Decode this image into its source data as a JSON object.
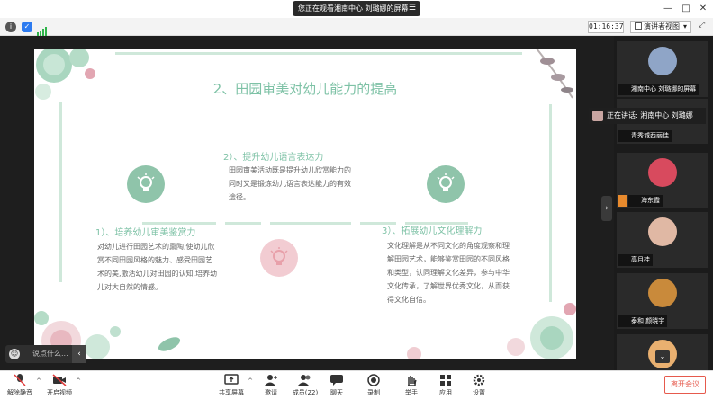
{
  "titlebar": {
    "share_notice": "您正在观看湘南中心 刘璐娜的屏幕",
    "menu_icon": "menu-lines-icon",
    "window_buttons": [
      "—",
      "□",
      "✕"
    ]
  },
  "statusbar": {
    "icons": [
      "info-icon",
      "shield-icon",
      "signal-icon"
    ],
    "timer": "01:16:37",
    "view_mode": "演讲者视图",
    "view_caret": "▾",
    "fullscreen_icon": "⤢"
  },
  "slide": {
    "title": "2、田园审美对幼儿能力的提高",
    "sections": [
      {
        "heading": "2）、提升幼儿语言表达力",
        "body": "田园审美活动既是提升幼儿欣赏能力的同时又是锻炼幼儿语言表达能力的有效途径。"
      },
      {
        "heading": "1）、培养幼儿审美鉴赏力",
        "body": "对幼儿进行田园艺术的熏陶,使幼儿欣赏不同田园风格的魅力、感受田园艺术的美,激活幼儿对田园的认知,培养幼儿对大自然的情感。"
      },
      {
        "heading": "3）、拓展幼儿文化理解力",
        "body": "文化理解是从不同文化的角度观察和理解田园艺术，能够鉴赏田园的不同风格和类型，认同理解文化差异，参与中华文化传承，了解世界优秀文化，从而获得文化自信。"
      }
    ],
    "colors": {
      "accent": "#7ec2a6",
      "pink": "#e8a9b0",
      "line": "#cfe8da"
    }
  },
  "chat": {
    "placeholder": "说点什么...",
    "collapse_icon": "‹",
    "smile_icon": "☺"
  },
  "side_toggle": "›",
  "speaking": {
    "text": "正在讲话: 湘南中心 刘璐娜"
  },
  "participants": [
    {
      "name": "湘南中心 刘璐娜的屏幕",
      "avatar": "#8fa5c7",
      "host": false
    },
    {
      "name": "青秀城西丽佳",
      "avatar": "#555555",
      "host": false
    },
    {
      "name": "海东霞",
      "avatar": "#d84a5e",
      "host": true
    },
    {
      "name": "高月桂",
      "avatar": "#e0b8a4",
      "host": false
    },
    {
      "name": "泰和 颜晓宇",
      "avatar": "#c98a3b",
      "host": false
    },
    {
      "name": "",
      "avatar": "#e9b070",
      "host": false
    }
  ],
  "toolbar": {
    "items": [
      {
        "label": "解除静音",
        "icon": "mic-muted-icon",
        "caret": "^"
      },
      {
        "label": "开启视频",
        "icon": "camera-off-icon",
        "caret": "^"
      },
      {
        "label": "共享屏幕",
        "icon": "share-screen-icon",
        "caret": "^"
      },
      {
        "label": "邀请",
        "icon": "invite-icon",
        "caret": ""
      },
      {
        "label": "成员(22)",
        "icon": "members-icon",
        "caret": ""
      },
      {
        "label": "聊天",
        "icon": "chat-icon",
        "caret": ""
      },
      {
        "label": "录制",
        "icon": "record-icon",
        "caret": ""
      },
      {
        "label": "举手",
        "icon": "hand-icon",
        "caret": ""
      },
      {
        "label": "应用",
        "icon": "apps-icon",
        "caret": ""
      },
      {
        "label": "设置",
        "icon": "settings-icon",
        "caret": ""
      }
    ],
    "leave_label": "离开会议"
  }
}
